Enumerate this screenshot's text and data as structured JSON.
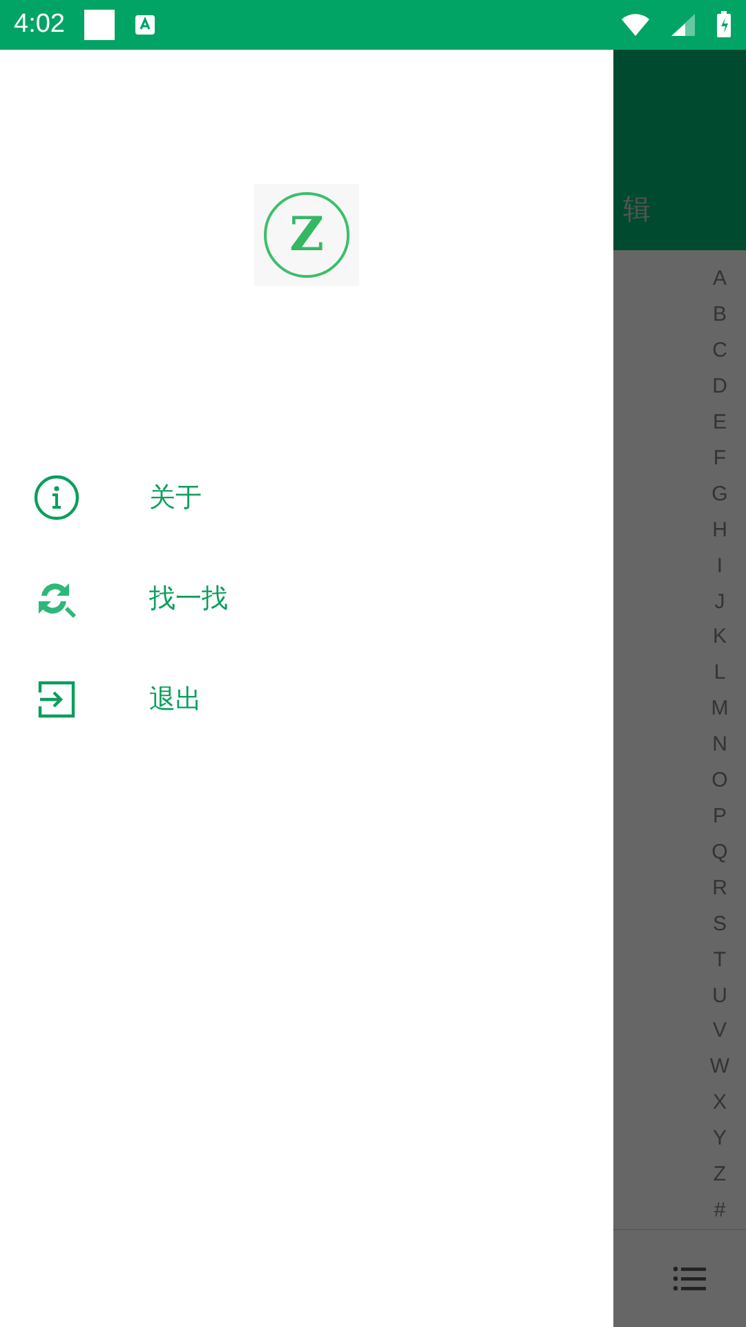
{
  "status_bar": {
    "time": "4:02"
  },
  "app_bar": {
    "title_fragment": "辑"
  },
  "index_letters": [
    "A",
    "B",
    "C",
    "D",
    "E",
    "F",
    "G",
    "H",
    "I",
    "J",
    "K",
    "L",
    "M",
    "N",
    "O",
    "P",
    "Q",
    "R",
    "S",
    "T",
    "U",
    "V",
    "W",
    "X",
    "Y",
    "Z",
    "#"
  ],
  "drawer": {
    "logo_letter": "Z",
    "items": [
      {
        "kind": "info",
        "label": "关于"
      },
      {
        "kind": "search",
        "label": "找一找"
      },
      {
        "kind": "exit",
        "label": "退出"
      }
    ]
  }
}
